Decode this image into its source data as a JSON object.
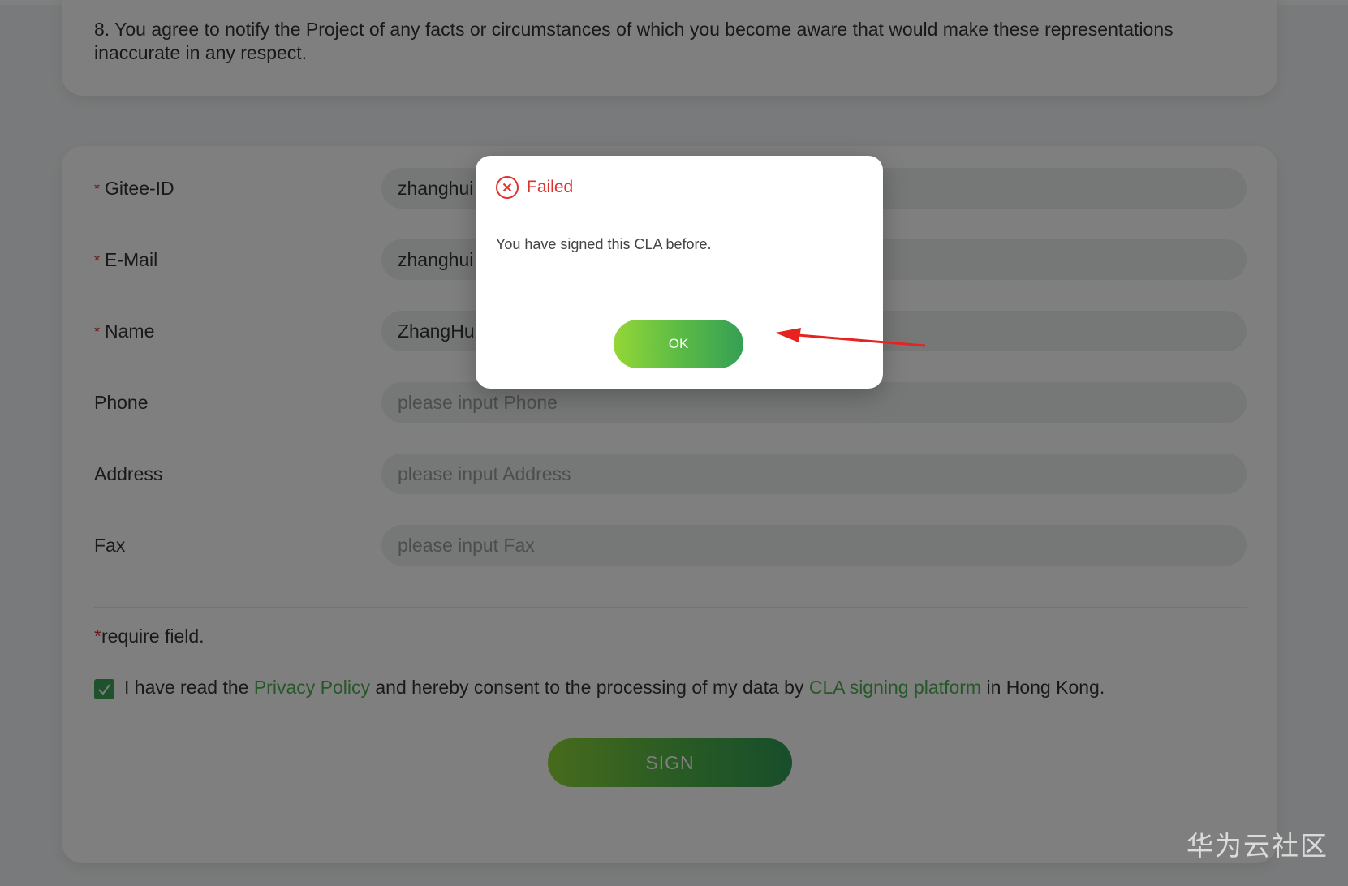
{
  "terms": {
    "clause_8": "8. You agree to notify the Project of any facts or circumstances of which you become aware that would make these representations inaccurate in any respect."
  },
  "form": {
    "required_star": "*",
    "fields": [
      {
        "label": "Gitee-ID",
        "required": true,
        "value": "zhanghui",
        "placeholder": ""
      },
      {
        "label": "E-Mail",
        "required": true,
        "value": "zhanghui",
        "placeholder": ""
      },
      {
        "label": "Name",
        "required": true,
        "value": "ZhangHu",
        "placeholder": ""
      },
      {
        "label": "Phone",
        "required": false,
        "value": "",
        "placeholder": "please input Phone"
      },
      {
        "label": "Address",
        "required": false,
        "value": "",
        "placeholder": "please input Address"
      },
      {
        "label": "Fax",
        "required": false,
        "value": "",
        "placeholder": "please input Fax"
      }
    ],
    "require_note": "require field.",
    "consent": {
      "checked": true,
      "text_1": "I have read the ",
      "privacy_link": "Privacy Policy",
      "text_2": " and hereby consent to the processing of my data by ",
      "platform_link": "CLA signing platform",
      "text_3": " in Hong Kong."
    },
    "sign_label": "SIGN"
  },
  "dialog": {
    "title": "Failed",
    "message": "You have signed this CLA before.",
    "ok_label": "OK",
    "icon": "error-circle-icon"
  },
  "colors": {
    "error": "#e03131",
    "accent_green": "#4caf50",
    "annotation_arrow": "#e8231f"
  },
  "watermark": "华为云社区"
}
